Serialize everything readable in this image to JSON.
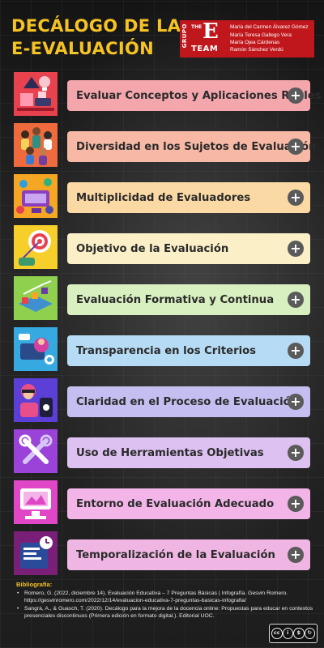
{
  "header": {
    "title_line1": "DECÁLOGO DE LA",
    "title_line2": "E-EVALUACIÓN",
    "logo": {
      "side": "GRUPO",
      "the": "THE",
      "e": "E",
      "team": "TEAM"
    },
    "authors": [
      "María del Carmen Álvarez Gómez",
      "María Teresa Gallego Vera",
      "María Ojea Cárdenas",
      "Ramón Sánchez Verdú"
    ]
  },
  "items": [
    {
      "label": "Evaluar Conceptos y Aplicaciones Reales",
      "icon": "shapes-lightbulb-icon",
      "bar_color": "#f4a6ad",
      "icon_color": "#e8424f"
    },
    {
      "label": "Diversidad en los Sujetos de Evaluación",
      "icon": "diverse-people-icon",
      "bar_color": "#f7b9a5",
      "icon_color": "#ef6a3d"
    },
    {
      "label": "Multiplicidad de Evaluadores",
      "icon": "multiple-evaluators-icon",
      "bar_color": "#fbd9a4",
      "icon_color": "#f5a623"
    },
    {
      "label": "Objetivo de la Evaluación",
      "icon": "target-icon",
      "bar_color": "#fbefc7",
      "icon_color": "#f7cf2a"
    },
    {
      "label": "Evaluación Formativa y Continua",
      "icon": "continuous-progress-icon",
      "bar_color": "#d8efc0",
      "icon_color": "#8fd14f"
    },
    {
      "label": "Transparencia en los Criterios",
      "icon": "transparency-icon",
      "bar_color": "#b6dcf5",
      "icon_color": "#36a9e1"
    },
    {
      "label": "Claridad en el Proceso de Evaluación",
      "icon": "clarity-touch-icon",
      "bar_color": "#c5bff1",
      "icon_color": "#5b3fd6"
    },
    {
      "label": "Uso de Herramientas Objetivas",
      "icon": "tools-icon",
      "bar_color": "#dcc1f1",
      "icon_color": "#9b42d9"
    },
    {
      "label": "Entorno de Evaluación Adecuado",
      "icon": "environment-screen-icon",
      "bar_color": "#f3b5e8",
      "icon_color": "#df47c6"
    },
    {
      "label": "Temporalización de la Evaluación",
      "icon": "calendar-clock-icon",
      "bar_color": "#f0b6e3",
      "icon_color": "#7a1f78"
    }
  ],
  "plus_symbol": "+",
  "bibliography": {
    "heading": "Bibliografía:",
    "entries": [
      "Romero, G. (2022, diciembre 14). Evaluación Educativa – 7 Preguntas Básicas | Infografía. Gesvin Romero. https://gesvinromero.com/2022/12/14/evaluacion-educativa-7-preguntas-basicas-infografia/",
      "Sangrà, A., & Guasch, T. (2020). Decálogo para la mejora de la docencia online: Propuestas para educar en contextos presenciales discontinuos (Primera edición en formato digital.). Editorial UOC."
    ]
  },
  "license": {
    "icons": [
      "cc",
      "by",
      "nc",
      "sa"
    ],
    "symbols": [
      "cc",
      "i",
      "$",
      "↻"
    ],
    "labels": [
      "BY",
      "NC",
      "SA"
    ]
  }
}
